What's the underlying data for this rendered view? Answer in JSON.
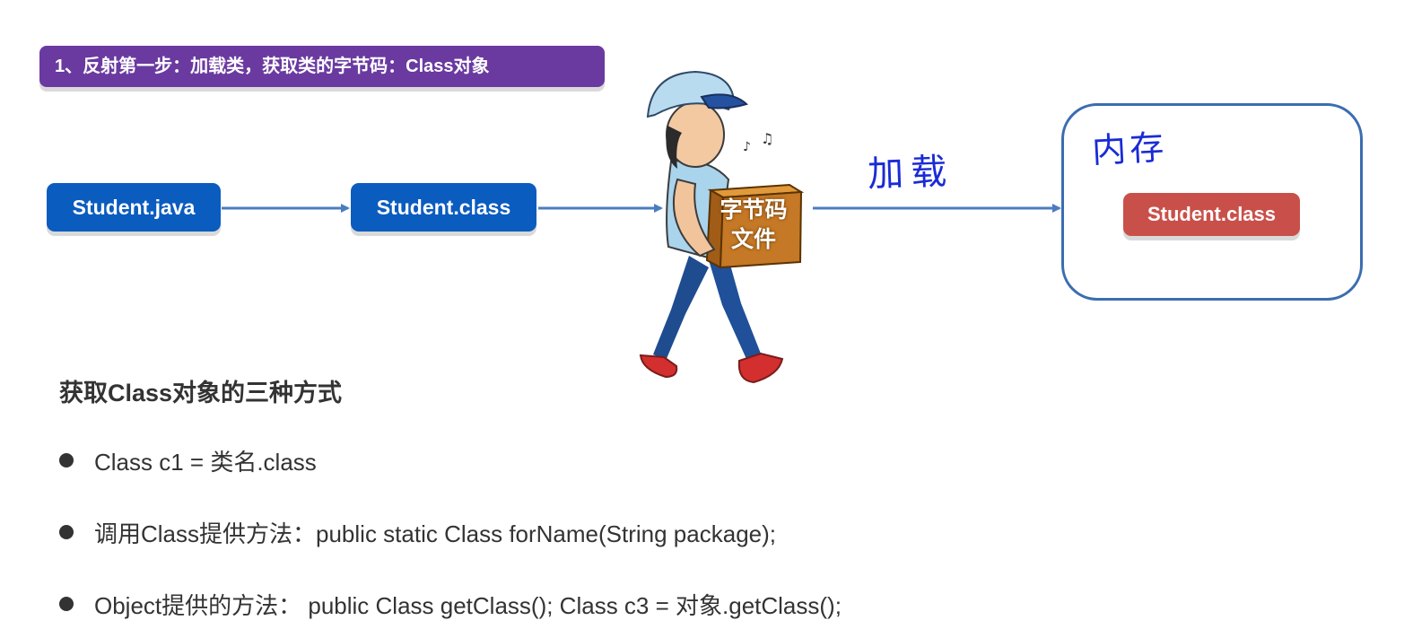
{
  "title": "1、反射第一步：加载类，获取类的字节码：Class对象",
  "flow": {
    "source_node": "Student.java",
    "compiled_node": "Student.class",
    "box_label_line1": "字节码",
    "box_label_line2": "文件",
    "load_label": "加载",
    "memory_label": "内存",
    "memory_node": "Student.class"
  },
  "colors": {
    "title_bg": "#6a3aa0",
    "node_blue": "#0b5cbf",
    "node_red": "#c9504a",
    "arrow": "#4a7cc0",
    "handwriting": "#1a2bd6"
  },
  "section": {
    "heading": "获取Class对象的三种方式",
    "items": [
      "Class c1 = 类名.class",
      "调用Class提供方法：public static Class forName(String package);",
      "Object提供的方法： public Class getClass();   Class c3 = 对象.getClass();"
    ]
  }
}
